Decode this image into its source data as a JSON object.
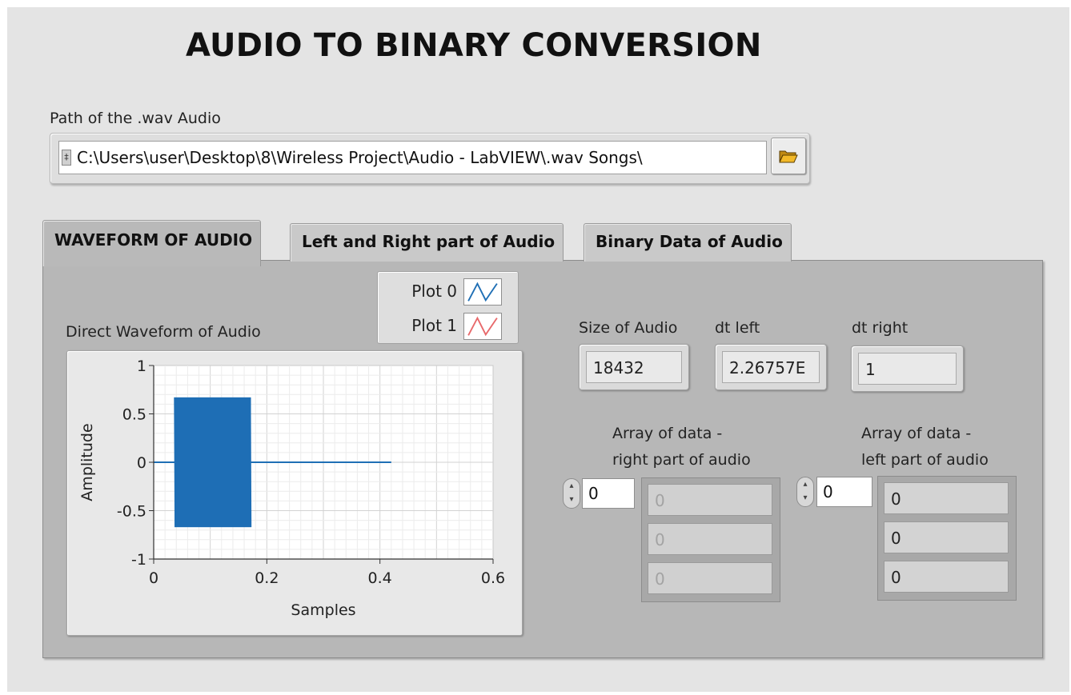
{
  "title": "AUDIO TO BINARY CONVERSION",
  "path_control": {
    "label": "Path of the .wav Audio",
    "value": "C:\\Users\\user\\Desktop\\8\\Wireless Project\\Audio - LabVIEW\\.wav Songs\\",
    "browse_icon": "folder-open-icon"
  },
  "tabs": [
    {
      "label": "WAVEFORM OF AUDIO",
      "selected": true
    },
    {
      "label": "Left and Right part of Audio",
      "selected": false
    },
    {
      "label": "Binary Data of Audio",
      "selected": false
    }
  ],
  "legend": [
    {
      "name": "Plot 0",
      "color": "#1f6fb5"
    },
    {
      "name": "Plot 1",
      "color": "#e8696b"
    }
  ],
  "graph_label": "Direct Waveform of Audio",
  "chart_data": {
    "type": "line",
    "title": "Direct Waveform of Audio",
    "xlabel": "Samples",
    "ylabel": "Amplitude",
    "xlim": [
      0,
      0.6
    ],
    "ylim": [
      -1,
      1
    ],
    "x_ticks": [
      "0",
      "0.2",
      "0.4",
      "0.6"
    ],
    "y_ticks": [
      "1",
      "0.5",
      "0",
      "-0.5",
      "-1"
    ],
    "grid": true,
    "series": [
      {
        "name": "Plot 0",
        "color": "#1f6fb5",
        "flat_segments": [
          {
            "x": [
              0,
              0.037
            ],
            "y": 0
          },
          {
            "x": [
              0.172,
              0.42
            ],
            "y": 0
          }
        ],
        "oscillation": {
          "x_start": 0.037,
          "x_end": 0.172,
          "y_min": -0.67,
          "y_max": 0.67
        }
      }
    ]
  },
  "indicators": [
    {
      "label": "Size of Audio",
      "value": "18432"
    },
    {
      "label": "dt left",
      "value": "2.26757E"
    },
    {
      "label": "dt right",
      "value": "1"
    }
  ],
  "arrays": [
    {
      "label_line1": "Array of data -",
      "label_line2": "right part of audio",
      "index": "0",
      "values": [
        "0",
        "0",
        "0"
      ],
      "dimmed": true
    },
    {
      "label_line1": "Array of data -",
      "label_line2": "left part of audio",
      "index": "0",
      "values": [
        "0",
        "0",
        "0"
      ],
      "dimmed": false
    }
  ]
}
